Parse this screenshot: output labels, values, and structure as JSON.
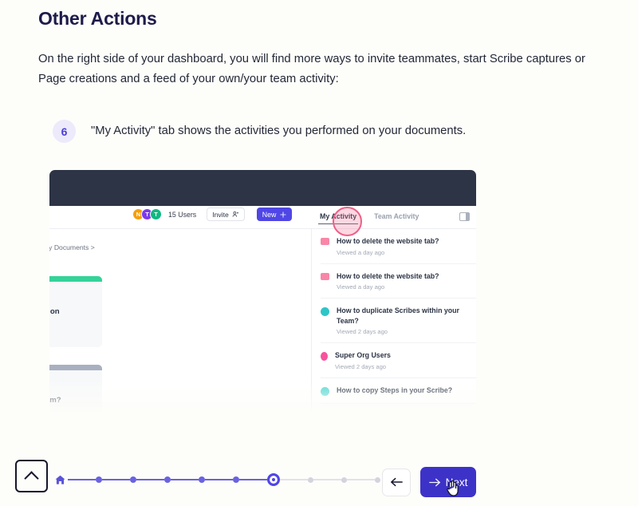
{
  "article": {
    "title": "Other Actions",
    "intro": "On the right side of your dashboard, you will find more ways to invite teammates, start Scribe captures or Page creations and a feed of your own/your team activity:"
  },
  "step": {
    "number": "6",
    "text": "\"My Activity\" tab shows the activities you performed on your documents."
  },
  "screenshot": {
    "toolbar": {
      "avatars": [
        {
          "initial": "N",
          "color": "#f59e0b"
        },
        {
          "initial": "T",
          "color": "#7c3aed"
        },
        {
          "initial": "T",
          "color": "#10b981"
        }
      ],
      "users_count": "15 Users",
      "invite_label": "Invite",
      "invite_icon": "add-person-icon",
      "new_label": "New",
      "new_icon": "plus-icon"
    },
    "left_canvas": {
      "breadcrumb": "My Documents >",
      "cards": [
        {
          "strip_color": "#34d399",
          "text": "hing on"
        },
        {
          "strip_color": "#a8b0c0",
          "text": "r Team?"
        }
      ]
    },
    "panel": {
      "tabs": [
        {
          "label": "My Activity",
          "active": true
        },
        {
          "label": "Team Activity",
          "active": false
        }
      ],
      "toggle_icon": "panel-toggle-icon",
      "items": [
        {
          "title": "How to delete the website tab?",
          "meta": "Viewed a day ago",
          "icon": "pink"
        },
        {
          "title": "How to delete the website tab?",
          "meta": "Viewed a day ago",
          "icon": "pink"
        },
        {
          "title": "How to duplicate Scribes within your Team?",
          "meta": "Viewed 2 days ago",
          "icon": "teal"
        },
        {
          "title": "Super Org Users",
          "meta": "Viewed 2 days ago",
          "icon": "magenta"
        },
        {
          "title": "How to copy Steps in your Scribe?",
          "meta": "",
          "icon": "cyan"
        }
      ]
    },
    "highlight_color": "#ef5f88"
  },
  "bottom_bar": {
    "collapse_icon": "chevron-up-icon",
    "home_icon": "home-icon",
    "progress": {
      "total_steps": 9,
      "current_index": 6
    },
    "back_label": "",
    "back_icon": "arrow-left-icon",
    "next_label": "Next",
    "next_icon": "arrow-right-icon",
    "cursor_icon": "hand-cursor-icon"
  },
  "colors": {
    "accent": "#4f46e5",
    "next_button": "#3d32c8",
    "header_dark": "#2c3445",
    "page_bg": "#fdfdfa",
    "highlight_pink": "#ef5f88"
  }
}
